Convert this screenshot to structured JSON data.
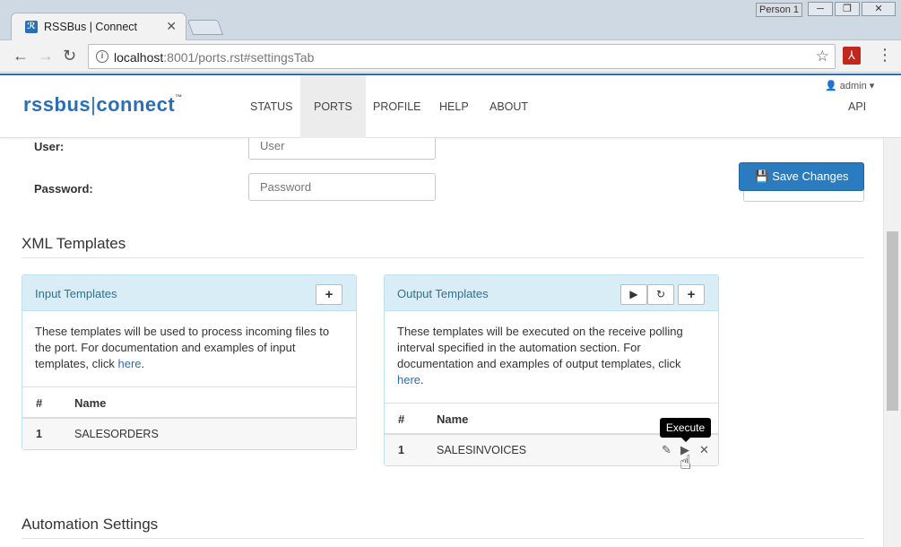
{
  "browser": {
    "tab_title": "RSSBus | Connect",
    "tab_close": "✕",
    "person": "Person 1",
    "url_host": "localhost",
    "url_rest": ":8001/ports.rst#settingsTab"
  },
  "app": {
    "logo_left": "rssbus",
    "logo_right": "connect",
    "logo_tm": "™",
    "nav": [
      {
        "label": "STATUS"
      },
      {
        "label": "PORTS"
      },
      {
        "label": "PROFILE"
      },
      {
        "label": "HELP"
      },
      {
        "label": "ABOUT"
      }
    ],
    "user_menu": "admin",
    "api": "API"
  },
  "settings": {
    "user_label": "User:",
    "user_placeholder": "User",
    "password_label": "Password:",
    "password_placeholder": "Password",
    "save_label": "Save Changes"
  },
  "xml_templates": {
    "title": "XML Templates",
    "input": {
      "title": "Input Templates",
      "description": "These templates will be used to process incoming files to the port. For documentation and examples of input templates, click ",
      "link": "here",
      "after_link": ".",
      "col_num": "#",
      "col_name": "Name",
      "rows": [
        {
          "num": "1",
          "name": "SALESORDERS"
        }
      ]
    },
    "output": {
      "title": "Output Templates",
      "description": "These templates will be executed on the receive polling interval specified in the automation section. For documentation and examples of output templates, click ",
      "link": "here",
      "after_link": ".",
      "col_num": "#",
      "col_name": "Name",
      "rows": [
        {
          "num": "1",
          "name": "SALESINVOICES"
        }
      ],
      "tooltip": "Execute"
    }
  },
  "automation": {
    "title": "Automation Settings"
  },
  "colors": {
    "brand": "#2a6fb4",
    "panel_head": "#d9edf7",
    "panel_title": "#31708f"
  }
}
